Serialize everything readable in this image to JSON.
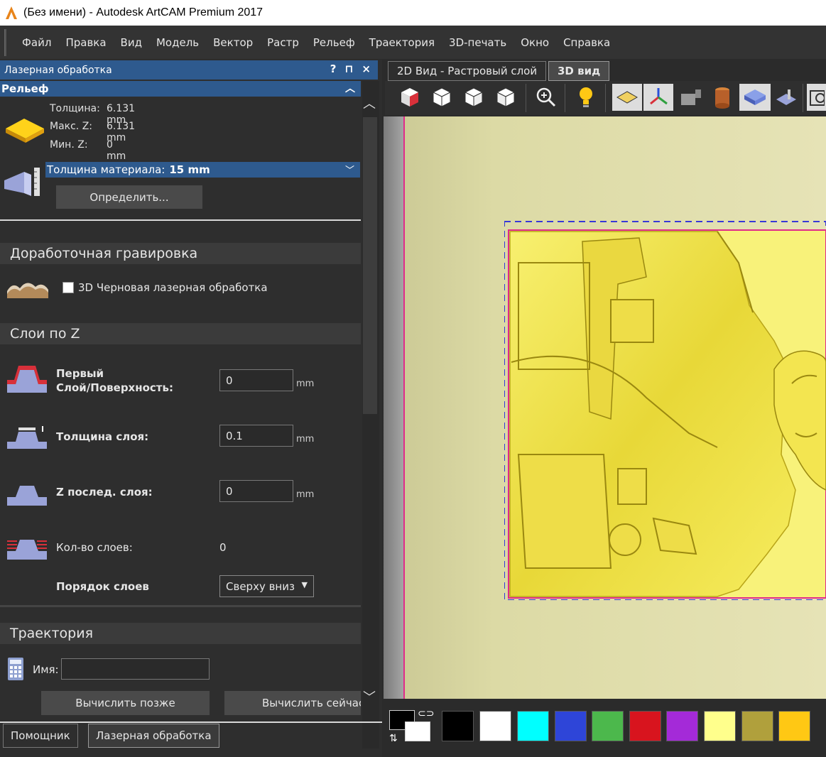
{
  "window": {
    "title": "(Без имени) - Autodesk ArtCAM Premium 2017"
  },
  "menu": [
    "Файл",
    "Правка",
    "Вид",
    "Модель",
    "Вектор",
    "Растр",
    "Рельеф",
    "Траектория",
    "3D-печать",
    "Окно",
    "Справка"
  ],
  "panel": {
    "title": "Лазерная обработка",
    "controls": {
      "help": "?",
      "pin": "⊓",
      "close": "×"
    },
    "relief": {
      "header": "Рельеф",
      "thickness_label": "Толщина:",
      "thickness_value": "6.131 mm",
      "maxz_label": "Макс. Z:",
      "maxz_value": "6.131 mm",
      "minz_label": "Мин. Z:",
      "minz_value": "0 mm",
      "material_label": "Толщина материала:",
      "material_value": "15 mm",
      "define_button": "Определить..."
    },
    "finishing": {
      "title": "Доработочная гравировка",
      "rough_label": "3D Черновая лазерная обработка"
    },
    "zlayers": {
      "title": "Слои по Z",
      "first_label": "Первый\nСлой/Поверхность:",
      "first_value": "0",
      "first_unit": "mm",
      "thickness_label": "Толщина слоя:",
      "thickness_value": "0.1",
      "thickness_unit": "mm",
      "last_label": "Z послед. слоя:",
      "last_value": "0",
      "last_unit": "mm",
      "count_label": "Кол-во слоев:",
      "count_value": "0",
      "order_label": "Порядок слоев",
      "order_value": "Сверху вниз"
    },
    "toolpath": {
      "title": "Траектория",
      "name_label": "Имя:",
      "name_value": "",
      "later_button": "Вычислить позже",
      "now_button": "Вычислить сейчас"
    },
    "bottom_tabs": [
      "Помощник",
      "Лазерная обработка"
    ]
  },
  "view_tabs": [
    "2D Вид - Растровый слой",
    "3D вид"
  ],
  "toolbar_icons": [
    "view-iso-icon",
    "view-top-icon",
    "view-front-icon",
    "view-side-icon",
    "zoom-icon",
    "light-icon",
    "plane-icon",
    "axes-icon",
    "model-icon",
    "material-icon",
    "shade-icon",
    "section-icon",
    "reset-view-icon"
  ],
  "palette": [
    "#000000",
    "#ffffff",
    "#00ffff",
    "#2e45d8",
    "#4cb84c",
    "#d8141e",
    "#a42ad8",
    "#ffff8c",
    "#b0a03c",
    "#ffc814"
  ]
}
